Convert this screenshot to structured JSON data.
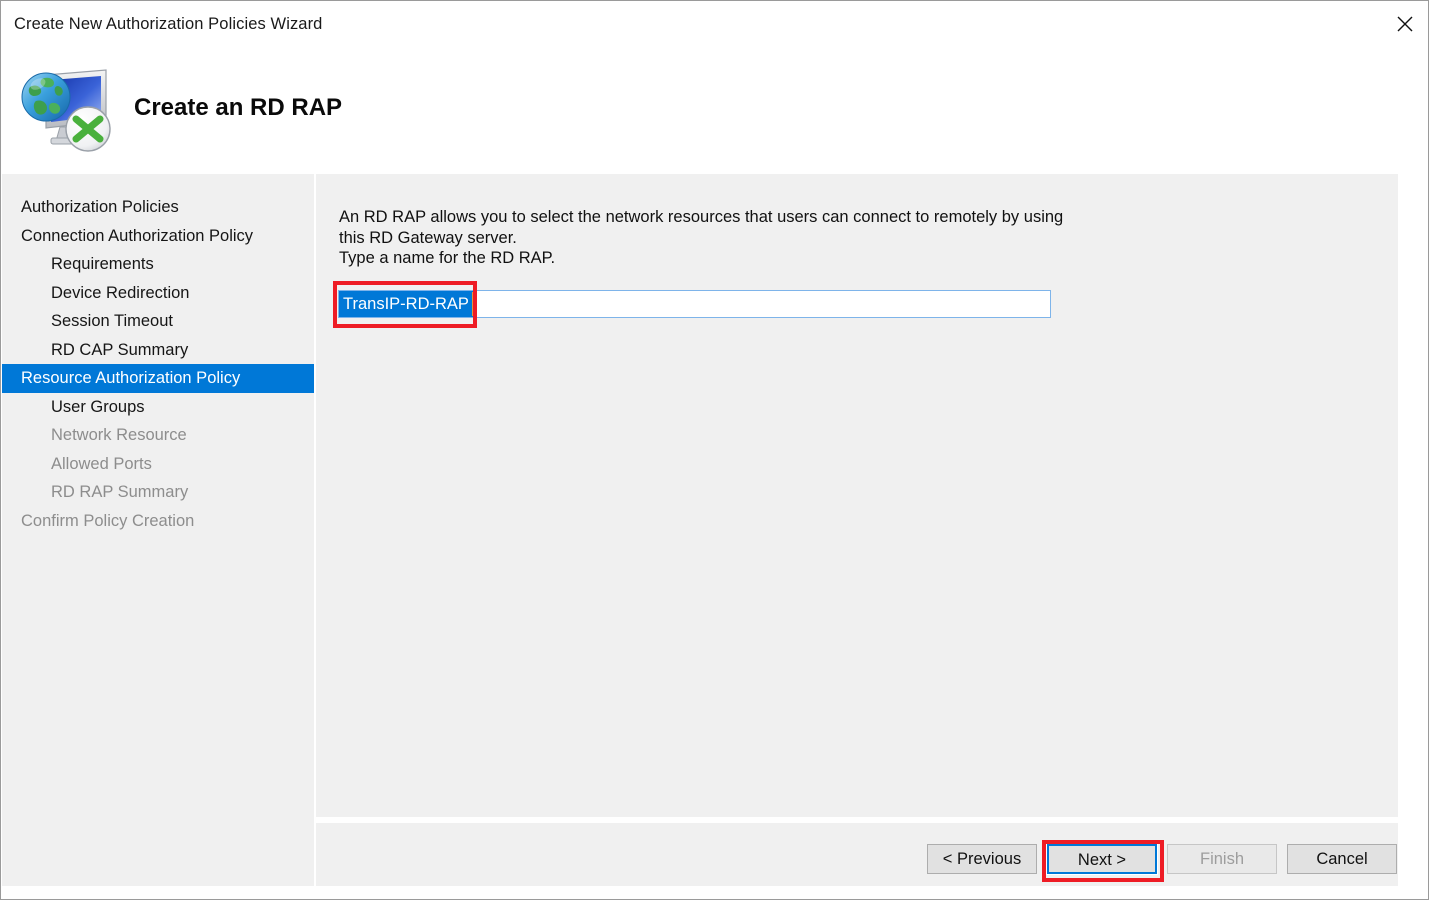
{
  "window": {
    "title": "Create New Authorization Policies Wizard",
    "close_icon": "close-icon"
  },
  "header": {
    "title": "Create an RD RAP",
    "icon": "rd-gateway-globe-monitor-icon"
  },
  "sidebar": {
    "items": [
      {
        "label": "Authorization Policies",
        "level": 0,
        "state": "enabled"
      },
      {
        "label": "Connection Authorization Policy",
        "level": 0,
        "state": "enabled"
      },
      {
        "label": "Requirements",
        "level": 1,
        "state": "enabled"
      },
      {
        "label": "Device Redirection",
        "level": 1,
        "state": "enabled"
      },
      {
        "label": "Session Timeout",
        "level": 1,
        "state": "enabled"
      },
      {
        "label": "RD CAP Summary",
        "level": 1,
        "state": "enabled"
      },
      {
        "label": "Resource Authorization Policy",
        "level": 0,
        "state": "selected"
      },
      {
        "label": "User Groups",
        "level": 1,
        "state": "enabled"
      },
      {
        "label": "Network Resource",
        "level": 1,
        "state": "disabled"
      },
      {
        "label": "Allowed Ports",
        "level": 1,
        "state": "disabled"
      },
      {
        "label": "RD RAP Summary",
        "level": 1,
        "state": "disabled"
      },
      {
        "label": "Confirm Policy Creation",
        "level": 0,
        "state": "disabled"
      }
    ]
  },
  "content": {
    "description": "An RD RAP allows you to select the network resources that users can connect to remotely by using this RD Gateway server.\nType a name for the RD RAP.",
    "name_field": {
      "value": "TransIP-RD-RAP",
      "placeholder": "",
      "selected_text": "TransIP-RD-RAP",
      "text_selected": true
    }
  },
  "buttons": {
    "previous": {
      "label": "< Previous",
      "state": "enabled"
    },
    "next": {
      "label": "Next >",
      "state": "focused"
    },
    "finish": {
      "label": "Finish",
      "state": "disabled"
    },
    "cancel": {
      "label": "Cancel",
      "state": "enabled"
    }
  },
  "annotations": [
    {
      "name": "name-field-highlight",
      "color": "#ee1c25"
    },
    {
      "name": "next-button-highlight",
      "color": "#ee1c25"
    }
  ],
  "colors": {
    "selection_blue": "#0078d7",
    "panel_gray": "#f0f0f0",
    "annotation_red": "#ee1c25",
    "input_border_blue": "#7eb4ea",
    "caret_orange": "#e8953c"
  }
}
